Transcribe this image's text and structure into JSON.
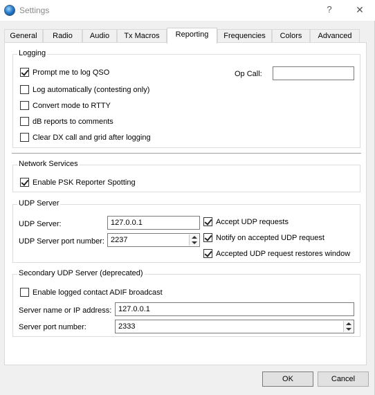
{
  "window": {
    "title": "Settings",
    "help_glyph": "?",
    "close_glyph": "✕"
  },
  "tabs": [
    {
      "label": "General"
    },
    {
      "label": "Radio"
    },
    {
      "label": "Audio"
    },
    {
      "label": "Tx Macros"
    },
    {
      "label": "Reporting",
      "active": true
    },
    {
      "label": "Frequencies"
    },
    {
      "label": "Colors"
    },
    {
      "label": "Advanced"
    }
  ],
  "logging": {
    "title": "Logging",
    "prompt_log_qso": {
      "label": "Prompt me to log QSO",
      "checked": true
    },
    "log_automatically": {
      "label": "Log automatically (contesting only)",
      "checked": false
    },
    "convert_mode": {
      "label": "Convert mode to RTTY",
      "checked": false
    },
    "db_reports": {
      "label": "dB reports to comments",
      "checked": false
    },
    "clear_dx": {
      "label": "Clear DX call and grid after logging",
      "checked": false
    },
    "op_call": {
      "label": "Op Call:",
      "value": ""
    }
  },
  "network": {
    "title": "Network Services",
    "psk_reporter": {
      "label": "Enable PSK Reporter Spotting",
      "checked": true
    }
  },
  "udp": {
    "title": "UDP Server",
    "server_label": "UDP Server:",
    "server_value": "127.0.0.1",
    "port_label": "UDP Server port number:",
    "port_value": "2237",
    "accept_requests": {
      "label": "Accept UDP requests",
      "checked": true
    },
    "notify_accepted": {
      "label": "Notify on accepted UDP request",
      "checked": true
    },
    "restores_window": {
      "label": "Accepted UDP request restores window",
      "checked": true
    }
  },
  "secondary_udp": {
    "title": "Secondary UDP Server (deprecated)",
    "adif_broadcast": {
      "label": "Enable logged contact ADIF broadcast",
      "checked": false
    },
    "server_label": "Server name or IP address:",
    "server_value": "127.0.0.1",
    "port_label": "Server port number:",
    "port_value": "2333"
  },
  "buttons": {
    "ok": "OK",
    "cancel": "Cancel"
  }
}
